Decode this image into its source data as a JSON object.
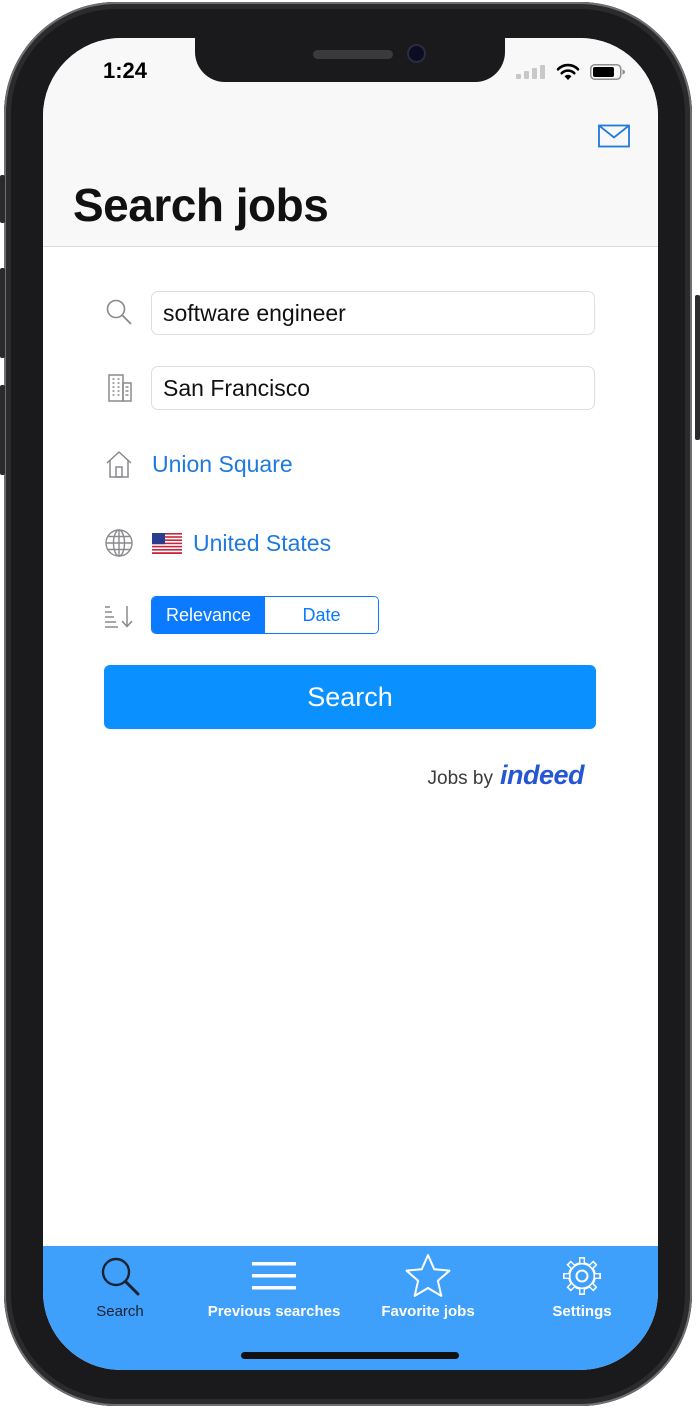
{
  "status_bar": {
    "time": "1:24"
  },
  "header": {
    "title": "Search jobs",
    "mail_icon": "mail-icon"
  },
  "form": {
    "keywords_value": "software engineer",
    "city_value": "San Francisco",
    "neighborhood_link": "Union Square",
    "country_flag": "🇺🇸",
    "country_link": "United States",
    "sort_options": [
      "Relevance",
      "Date"
    ],
    "sort_selected": "Relevance",
    "search_button": "Search"
  },
  "attribution": {
    "prefix": "Jobs by",
    "brand": "indeed"
  },
  "tabbar": {
    "items": [
      {
        "label": "Search",
        "icon": "search-icon",
        "active": true
      },
      {
        "label": "Previous searches",
        "icon": "list-icon",
        "active": false
      },
      {
        "label": "Favorite jobs",
        "icon": "star-icon",
        "active": false
      },
      {
        "label": "Settings",
        "icon": "gear-icon",
        "active": false
      }
    ]
  },
  "colors": {
    "accent": "#0a7aff",
    "button": "#0a90ff",
    "link": "#1f7ae0",
    "tabbar": "#3fa0fb",
    "brand": "#2557d4"
  }
}
